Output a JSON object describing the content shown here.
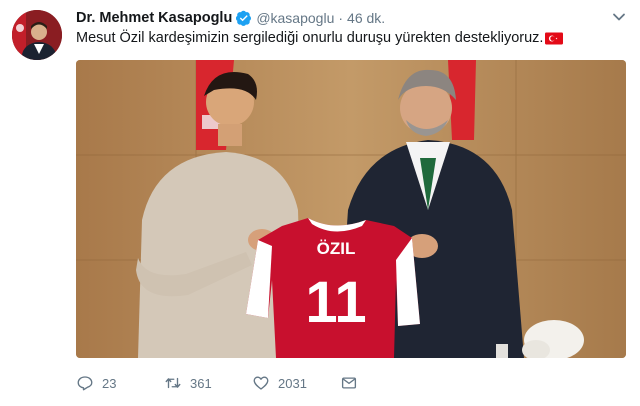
{
  "tweet": {
    "author": {
      "display_name": "Dr. Mehmet Kasapoglu",
      "handle": "@kasapoglu",
      "verified": true
    },
    "separator": "·",
    "time": "46 dk.",
    "text": "Mesut Özil kardeşimizin sergilediği onurlu duruşu yürekten destekliyoruz.",
    "text_emoji": "turkey-flag",
    "photo": {
      "jersey_name": "ÖZIL",
      "jersey_number": "11"
    },
    "actions": {
      "replies": "23",
      "retweets": "361",
      "likes": "2031"
    },
    "colors": {
      "secondary_text": "#657786",
      "verified_blue": "#1da1f2",
      "flag_red": "#e30a17",
      "jersey_red": "#c8102e"
    }
  }
}
